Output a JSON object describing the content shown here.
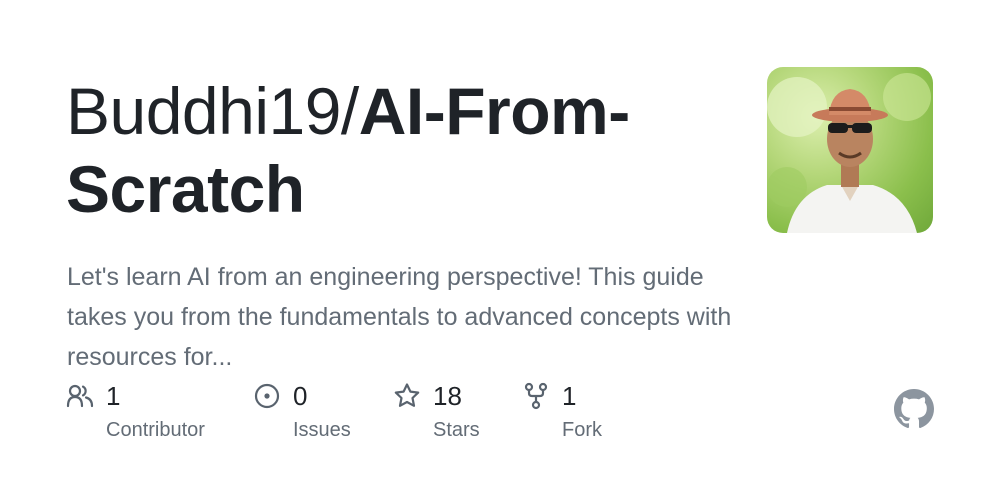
{
  "repo": {
    "owner_prefix": "Buddhi19/",
    "name": "AI-From-Scratch",
    "description": "Let's learn AI from an engineering perspective! This guide takes you from the fundamentals to advanced concepts with resources for..."
  },
  "stats": [
    {
      "icon": "people-icon",
      "count": "1",
      "label": "Contributor"
    },
    {
      "icon": "issue-circle-icon",
      "count": "0",
      "label": "Issues"
    },
    {
      "icon": "star-icon",
      "count": "18",
      "label": "Stars"
    },
    {
      "icon": "fork-icon",
      "count": "1",
      "label": "Fork"
    }
  ],
  "colors": {
    "text_primary": "#1f2328",
    "text_muted": "#636c76",
    "icon_muted": "#59636e",
    "github_mark": "#8c959f"
  }
}
